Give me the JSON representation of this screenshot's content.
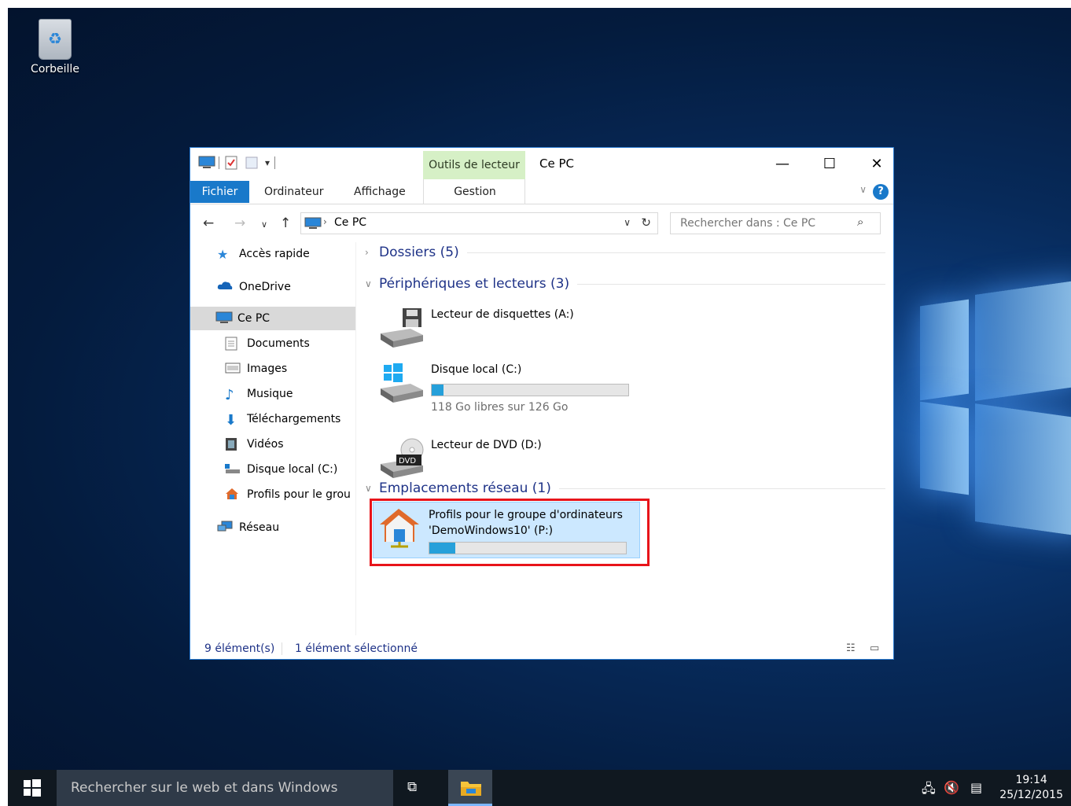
{
  "desktop": {
    "recycle_bin_label": "Corbeille"
  },
  "window": {
    "title": "Ce PC",
    "contextual_tab": "Outils de lecteur",
    "contextual_subtab": "Gestion",
    "tabs": [
      "Fichier",
      "Ordinateur",
      "Affichage"
    ],
    "address_crumb": "Ce PC",
    "search_placeholder": "Rechercher dans : Ce PC"
  },
  "sidebar": {
    "items": [
      {
        "label": "Accès rapide",
        "icon": "star-icon"
      },
      {
        "label": "OneDrive",
        "icon": "cloud-icon"
      },
      {
        "label": "Ce PC",
        "icon": "computer-icon",
        "selected": true
      },
      {
        "label": "Documents",
        "icon": "documents-icon"
      },
      {
        "label": "Images",
        "icon": "images-icon"
      },
      {
        "label": "Musique",
        "icon": "music-icon"
      },
      {
        "label": "Téléchargements",
        "icon": "download-icon"
      },
      {
        "label": "Vidéos",
        "icon": "videos-icon"
      },
      {
        "label": "Disque local (C:)",
        "icon": "drive-icon"
      },
      {
        "label": "Profils pour le grou",
        "icon": "network-drive-icon"
      },
      {
        "label": "Réseau",
        "icon": "network-icon"
      }
    ]
  },
  "groups": {
    "folders": "Dossiers (5)",
    "devices": "Périphériques et lecteurs (3)",
    "network": "Emplacements réseau (1)"
  },
  "drives": {
    "floppy": {
      "name": "Lecteur de disquettes (A:)"
    },
    "local": {
      "name": "Disque local (C:)",
      "free": "118 Go libres sur 126 Go",
      "used_fraction": 0.06
    },
    "dvd": {
      "name": "Lecteur de DVD (D:)",
      "badge": "DVD"
    },
    "network": {
      "name_line1": "Profils pour le groupe d'ordinateurs",
      "name_line2": "'DemoWindows10' (P:)",
      "used_fraction": 0.13
    }
  },
  "status": {
    "count": "9 élément(s)",
    "selection": "1 élément sélectionné"
  },
  "taskbar": {
    "search_placeholder": "Rechercher sur le web et dans Windows",
    "time": "19:14",
    "date": "25/12/2015"
  },
  "colors": {
    "accent": "#1979ca",
    "contextual_tab": "#d6f0c6",
    "highlight_box": "#e8141a",
    "progress": "#26a0da",
    "group_heading": "#1e3287"
  }
}
